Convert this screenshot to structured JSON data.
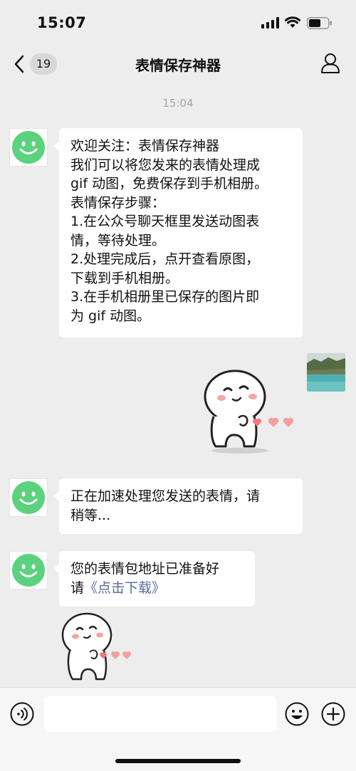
{
  "status_bar": {
    "time": "15:07"
  },
  "nav": {
    "unread_count": "19",
    "title": "表情保存神器"
  },
  "chat": {
    "timestamp": "15:04",
    "welcome_lines": [
      "欢迎关注：表情保存神器",
      "我们可以将您发来的表情处理成",
      "gif 动图，免费保存到手机相册。",
      "表情保存步骤：",
      "1.在公众号聊天框里发送动图表",
      "情，等待处理。",
      "2.处理完成后，点开查看原图，",
      "下载到手机相册。",
      "3.在手机相册里已保存的图片即",
      "为 gif 动图。"
    ],
    "processing_lines": [
      "正在加速处理您发送的表情，请",
      "稍等..."
    ],
    "ready_line": "您的表情包地址已准备好",
    "ready_prefix": "请",
    "download_link": "《点击下载》"
  },
  "icons": {
    "back": "chevron-left-icon",
    "profile": "person-icon",
    "voice": "voice-icon",
    "emoji": "emoji-icon",
    "plus": "plus-icon",
    "avatar": "smiley-avatar-icon"
  },
  "colors": {
    "background": "#ededed",
    "avatar_green": "#5bd27d",
    "link": "#576b95"
  }
}
